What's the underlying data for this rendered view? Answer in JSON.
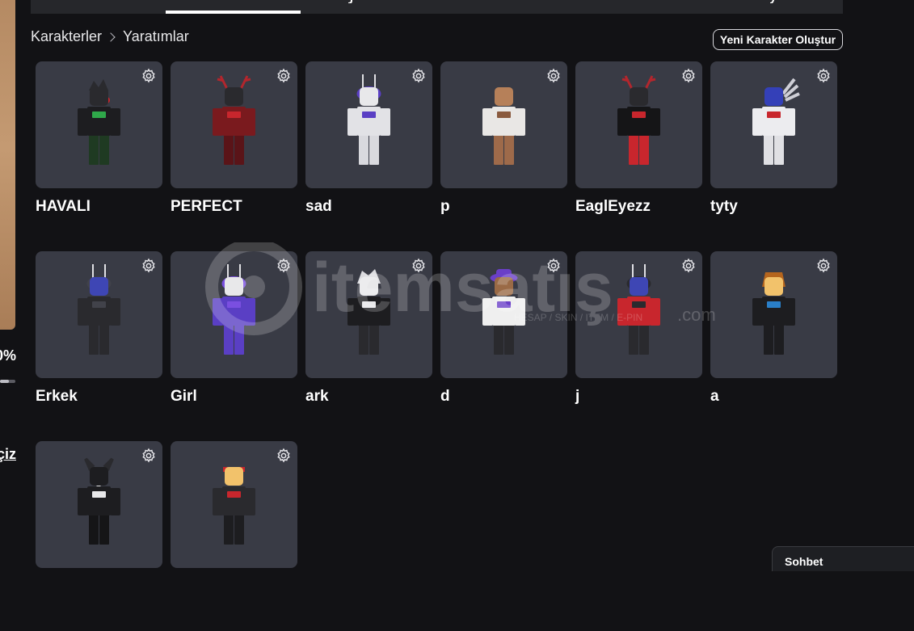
{
  "left_panel": {
    "percent_text": "0%",
    "link_text": "çiz",
    "progress_fraction": 0.6
  },
  "breadcrumb": {
    "parent": "Karakterler",
    "current": "Yaratımlar"
  },
  "actions": {
    "create_label": "Yeni Karakter Oluştur"
  },
  "icons": {
    "settings": "gear-icon",
    "breadcrumb_separator": "chevron-right-icon"
  },
  "characters": [
    {
      "name": "HAVALI",
      "head": "#2a2a2e",
      "torso": "#1d1d20",
      "accent": "#2fa84a",
      "legs": "#1f3a22",
      "extra": "hair-red"
    },
    {
      "name": "PERFECT",
      "head": "#2a2a2e",
      "torso": "#7a1a1e",
      "accent": "#c8262d",
      "legs": "#5a1418",
      "extra": "antlers"
    },
    {
      "name": "sad",
      "head": "#e8e8ea",
      "torso": "#e2e2e6",
      "accent": "#5a3fc4",
      "legs": "#d9d9de",
      "extra": "visor"
    },
    {
      "name": "p",
      "head": "#b68059",
      "torso": "#e9e7e5",
      "accent": "#8a5a3e",
      "legs": "#9e6a4a",
      "extra": "none"
    },
    {
      "name": "EaglEyezz",
      "head": "#2a2a2e",
      "torso": "#151517",
      "accent": "#c8262d",
      "legs": "#c8262d",
      "extra": "antlers"
    },
    {
      "name": "tyty",
      "head": "#3440b8",
      "torso": "#ececef",
      "accent": "#c8262d",
      "legs": "#e0e0e4",
      "extra": "wings"
    },
    {
      "name": "Erkek",
      "head": "#3e46b4",
      "torso": "#2a2a2e",
      "accent": "#41424a",
      "legs": "#2a2a2e",
      "extra": "visor"
    },
    {
      "name": "Girl",
      "head": "#e8e8ea",
      "torso": "#5a3fc4",
      "accent": "#7a4fe0",
      "legs": "#5a3fc4",
      "extra": "visor"
    },
    {
      "name": "ark",
      "head": "#e8e8ea",
      "torso": "#1d1d20",
      "accent": "#e8e8ea",
      "legs": "#2a2a2e",
      "extra": "hair-white"
    },
    {
      "name": "d",
      "head": "#9a6a46",
      "torso": "#efefef",
      "accent": "#6a3fc8",
      "legs": "#2a2a2e",
      "extra": "hat"
    },
    {
      "name": "j",
      "head": "#3e46b4",
      "torso": "#c8262d",
      "accent": "#2a2a2e",
      "legs": "#2a2a2e",
      "extra": "visor"
    },
    {
      "name": "a",
      "head": "#f2c26b",
      "torso": "#1d1d20",
      "accent": "#2a7fc8",
      "legs": "#1d1d20",
      "extra": "hair-brown"
    },
    {
      "name": "",
      "head": "#1d1d20",
      "torso": "#1d1d20",
      "accent": "#e8e8ea",
      "legs": "#151517",
      "extra": "horns"
    },
    {
      "name": "",
      "head": "#f2c26b",
      "torso": "#2a2a2e",
      "accent": "#c8262d",
      "legs": "#1d1d20",
      "extra": "bandana"
    }
  ],
  "watermark": {
    "brand": "itemsatış",
    "tld": ".com",
    "tagline": "HESAP / SKIN / ITEM / E-PIN"
  },
  "chat": {
    "label": "Sohbet"
  },
  "colors": {
    "background": "#121215",
    "card": "#393b45",
    "tab_bar": "#26272b"
  }
}
